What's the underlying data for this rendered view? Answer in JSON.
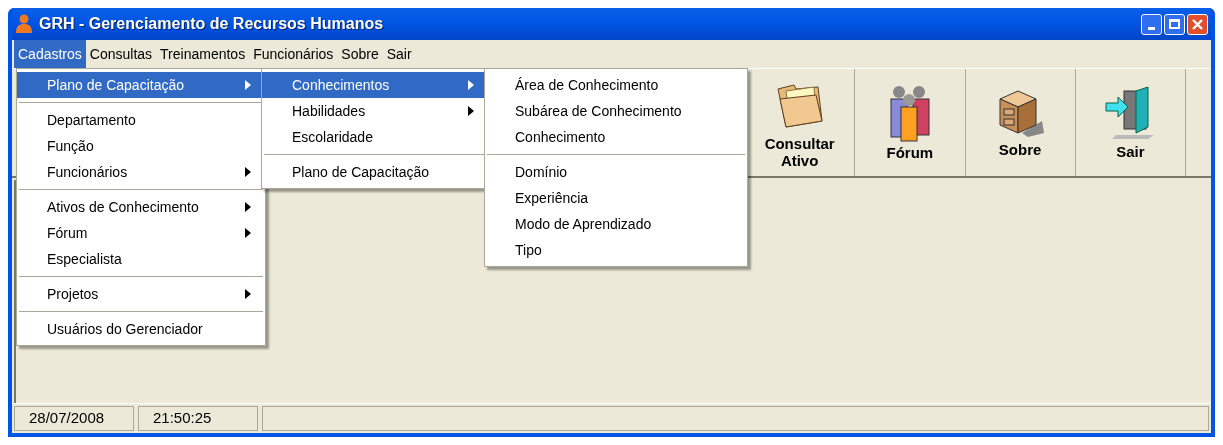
{
  "window": {
    "title": "GRH - Gerenciamento de Recursos Humanos"
  },
  "menubar": [
    {
      "label": "Cadastros",
      "selected": true,
      "children": [
        {
          "kind": "item",
          "label": "Plano de Capacitação",
          "has_submenu": true,
          "selected": true,
          "children": [
            {
              "kind": "item",
              "label": "Conhecimentos",
              "has_submenu": true,
              "selected": true,
              "children": [
                {
                  "kind": "item",
                  "label": "Área de Conhecimento",
                  "has_submenu": false,
                  "selected": false
                },
                {
                  "kind": "item",
                  "label": "Subárea de Conhecimento",
                  "has_submenu": false,
                  "selected": false
                },
                {
                  "kind": "item",
                  "label": "Conhecimento",
                  "has_submenu": false,
                  "selected": false
                },
                {
                  "kind": "separator"
                },
                {
                  "kind": "item",
                  "label": "Domínio",
                  "has_submenu": false,
                  "selected": false
                },
                {
                  "kind": "item",
                  "label": "Experiência",
                  "has_submenu": false,
                  "selected": false
                },
                {
                  "kind": "item",
                  "label": "Modo de Aprendizado",
                  "has_submenu": false,
                  "selected": false
                },
                {
                  "kind": "item",
                  "label": "Tipo",
                  "has_submenu": false,
                  "selected": false
                }
              ]
            },
            {
              "kind": "item",
              "label": "Habilidades",
              "has_submenu": true,
              "selected": false
            },
            {
              "kind": "item",
              "label": "Escolaridade",
              "has_submenu": false,
              "selected": false
            },
            {
              "kind": "separator"
            },
            {
              "kind": "item",
              "label": "Plano de Capacitação",
              "has_submenu": false,
              "selected": false
            }
          ]
        },
        {
          "kind": "separator"
        },
        {
          "kind": "item",
          "label": "Departamento",
          "has_submenu": false,
          "selected": false
        },
        {
          "kind": "item",
          "label": "Função",
          "has_submenu": false,
          "selected": false
        },
        {
          "kind": "item",
          "label": "Funcionários",
          "has_submenu": true,
          "selected": false
        },
        {
          "kind": "separator"
        },
        {
          "kind": "item",
          "label": "Ativos de Conhecimento",
          "has_submenu": true,
          "selected": false
        },
        {
          "kind": "item",
          "label": "Fórum",
          "has_submenu": true,
          "selected": false
        },
        {
          "kind": "item",
          "label": "Especialista",
          "has_submenu": false,
          "selected": false
        },
        {
          "kind": "separator"
        },
        {
          "kind": "item",
          "label": "Projetos",
          "has_submenu": true,
          "selected": false
        },
        {
          "kind": "separator"
        },
        {
          "kind": "item",
          "label": "Usuários do Gerenciador",
          "has_submenu": false,
          "selected": false
        }
      ]
    },
    {
      "label": "Consultas",
      "selected": false
    },
    {
      "label": "Treinamentos",
      "selected": false
    },
    {
      "label": "Funcionários",
      "selected": false
    },
    {
      "label": "Sobre",
      "selected": false
    },
    {
      "label": "Sair",
      "selected": false
    }
  ],
  "toolbar": [
    {
      "kind": "folder",
      "label": "Consultar Ativo"
    },
    {
      "kind": "people",
      "label": "Fórum"
    },
    {
      "kind": "cabinet",
      "label": "Sobre"
    },
    {
      "kind": "exit",
      "label": "Sair"
    }
  ],
  "status_bar": [
    "28/07/2008",
    "21:50:25"
  ]
}
